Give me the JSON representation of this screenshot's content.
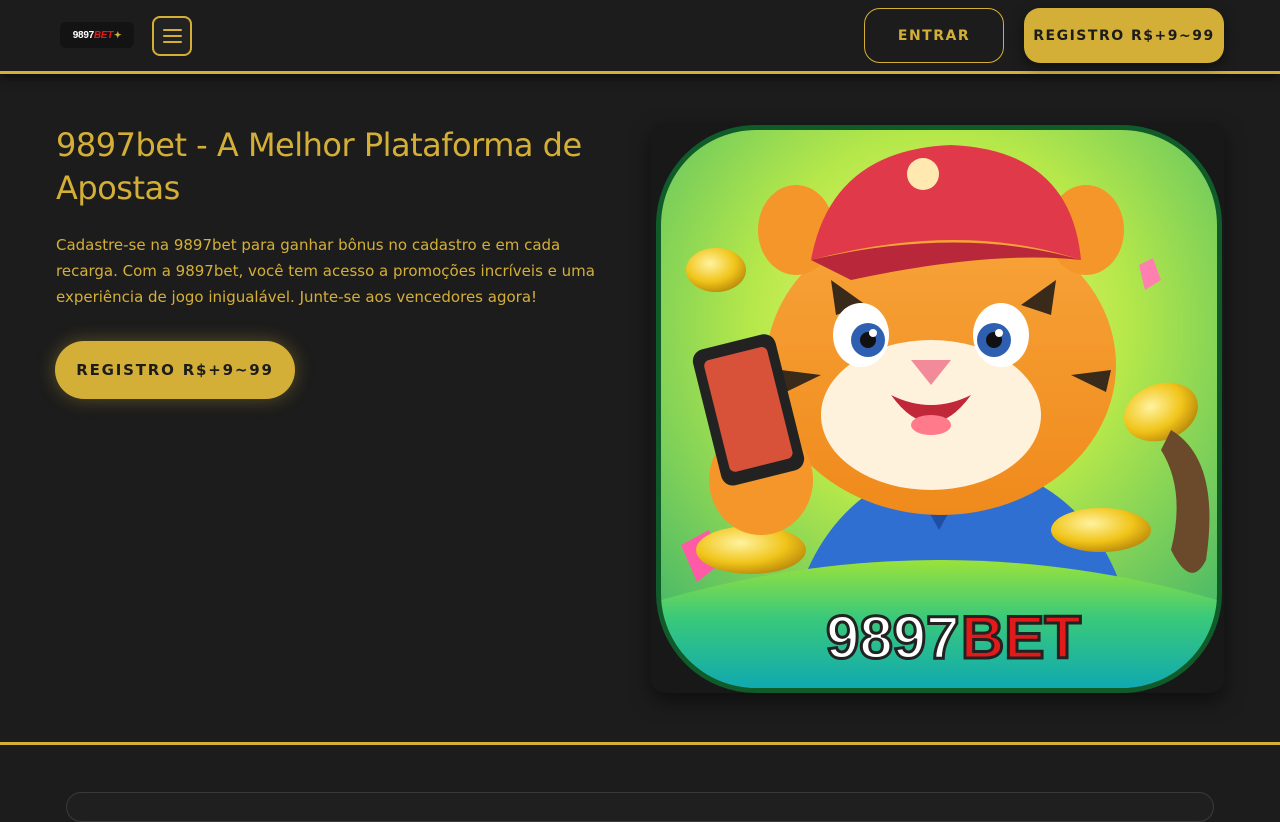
{
  "header": {
    "logo": {
      "number": "9897",
      "bet": "BET"
    },
    "menu_icon": "hamburger-menu-icon",
    "login_label": "ENTRAR",
    "register_label": "REGISTRO R$+9~99"
  },
  "hero": {
    "title": "9897bet - A Melhor Plataforma de Apostas",
    "description": "Cadastre-se na 9897bet para ganhar bônus no cadastro e em cada recarga. Com a 9897bet, você tem acesso a promoções incríveis e uma experiência de jogo inigualável. Junte-se aos vencedores agora!",
    "cta_label": "REGISTRO R$+9~99",
    "image": {
      "logo_number": "9897",
      "logo_bet": "BET"
    }
  },
  "colors": {
    "accent": "#d4af37",
    "background": "#1c1c1c",
    "brand_red": "#e21a1a"
  }
}
